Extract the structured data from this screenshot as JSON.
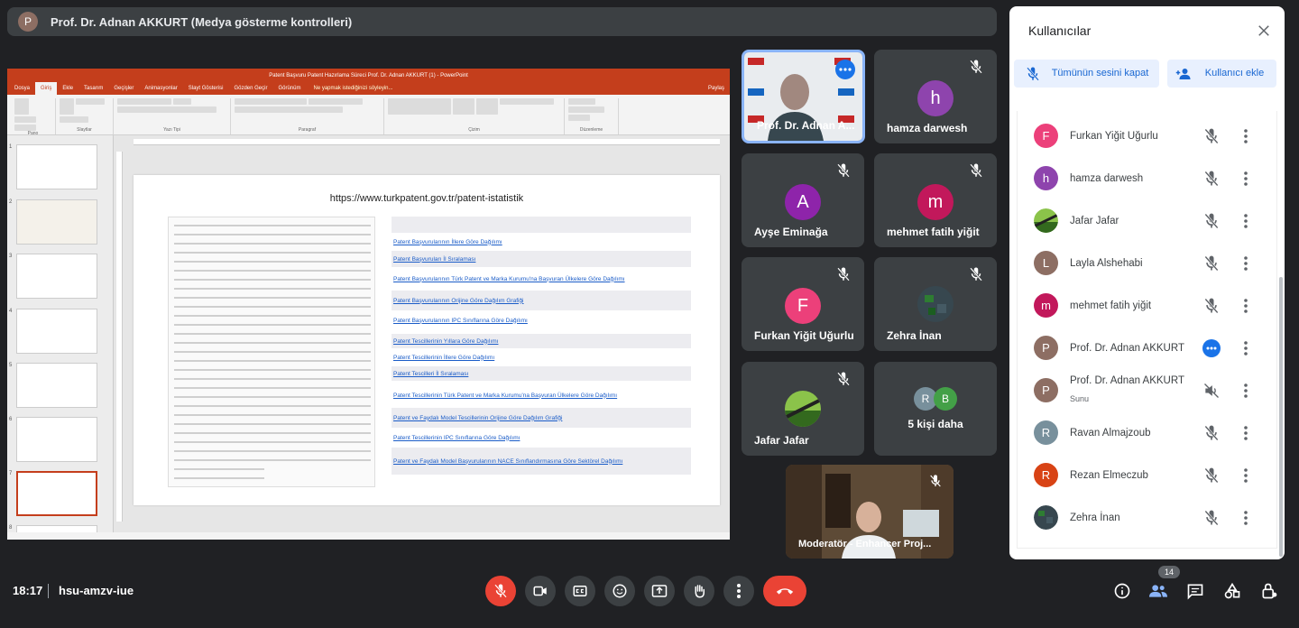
{
  "topbar": {
    "avatar_letter": "P",
    "title": "Prof. Dr. Adnan AKKURT (Medya gösterme kontrolleri)"
  },
  "powerpoint": {
    "window_title": "Patent Başvuru Patent Hazırlama Süreci Prof. Dr. Adnan AKKURT (1) - PowerPoint",
    "tabs": [
      "Dosya",
      "Giriş",
      "Ekle",
      "Tasarım",
      "Geçişler",
      "Animasyonlar",
      "Slayt Gösterisi",
      "Gözden Geçir",
      "Görünüm"
    ],
    "tell_me": "Ne yapmak istediğinizi söyleyin...",
    "share": "Paylaş",
    "ribbon_groups": [
      "Pano",
      "Slaytlar",
      "Yazı Tipi",
      "Paragraf",
      "Çizim",
      "Düzenleme"
    ],
    "thumbnail_numbers": [
      "1",
      "2",
      "3",
      "4",
      "5",
      "6",
      "7",
      "8"
    ],
    "slide_url": "https://www.turkpatent.gov.tr/patent-istatistik",
    "links": [
      "Patent Başvurularının İllere Göre Dağılımı",
      "Patent Başvuruları İl Sıralaması",
      "Patent Başvurularının Türk Patent ve Marka Kurumu'na Başvuran Ülkelere Göre Dağılımı",
      "Patent Başvurularının Orijine Göre Dağılım Grafiği",
      "Patent Başvurularının IPC Sınıflarına Göre Dağılımı",
      "Patent Tescillerinin Yıllara Göre Dağılımı",
      "Patent Tescillerinin İllere Göre Dağılımı",
      "Patent Tescilleri İl Sıralaması",
      "Patent Tescillerinin Türk Patent ve Marka Kurumu'na Başvuran Ülkelere Göre Dağılımı",
      "Patent ve Faydalı Model Tescillerinin Orijine Göre Dağılım Grafiği",
      "Patent Tescillerinin IPC Sınıflarına Göre Dağılımı",
      "Patent ve Faydalı Model Başvurularının NACE Sınıflandırmasına Göre Sektörel Dağılımı"
    ]
  },
  "tiles": [
    {
      "name": "Prof. Dr. Adnan A...",
      "type": "video"
    },
    {
      "name": "hamza darwesh",
      "letter": "h",
      "color": "#8e44ad"
    },
    {
      "name": "Ayşe Eminağa",
      "letter": "A",
      "color": "#8e24aa"
    },
    {
      "name": "mehmet fatih yiğit",
      "letter": "m",
      "color": "#c2185b"
    },
    {
      "name": "Furkan Yiğit Uğurlu",
      "letter": "F",
      "color": "#ec407a"
    },
    {
      "name": "Zehra İnan",
      "type": "image"
    },
    {
      "name": "Jafar Jafar",
      "type": "image"
    },
    {
      "name": "5 kişi daha",
      "letters": [
        "R",
        "B"
      ],
      "colors": [
        "#78909c",
        "#43a047"
      ]
    }
  ],
  "self_tile": {
    "name": "Moderatör - Enhancer Proj..."
  },
  "panel": {
    "title": "Kullanıcılar",
    "mute_all": "Tümünün sesini kapat",
    "add_user": "Kullanıcı ekle",
    "people": [
      {
        "name": "Furkan Yiğit Uğurlu",
        "letter": "F",
        "color": "#ec407a"
      },
      {
        "name": "hamza darwesh",
        "letter": "h",
        "color": "#8e44ad"
      },
      {
        "name": "Jafar Jafar",
        "letter": "",
        "color": "#5d7c3a"
      },
      {
        "name": "Layla Alshehabi",
        "letter": "L",
        "color": "#8d6e63"
      },
      {
        "name": "mehmet fatih yiğit",
        "letter": "m",
        "color": "#c2185b"
      },
      {
        "name": "Prof. Dr. Adnan AKKURT",
        "letter": "P",
        "color": "#8d6e63"
      },
      {
        "name": "Prof. Dr. Adnan AKKURT",
        "sub": "Sunu",
        "letter": "P",
        "color": "#8d6e63"
      },
      {
        "name": "Ravan Almajzoub",
        "letter": "R",
        "color": "#78909c"
      },
      {
        "name": "Rezan Elmeczub",
        "letter": "R",
        "color": "#d84315"
      },
      {
        "name": "Zehra İnan",
        "letter": "",
        "color": "#37474f"
      }
    ]
  },
  "bottom": {
    "time": "18:17",
    "meeting_code": "hsu-amzv-iue",
    "participant_count": "14"
  }
}
